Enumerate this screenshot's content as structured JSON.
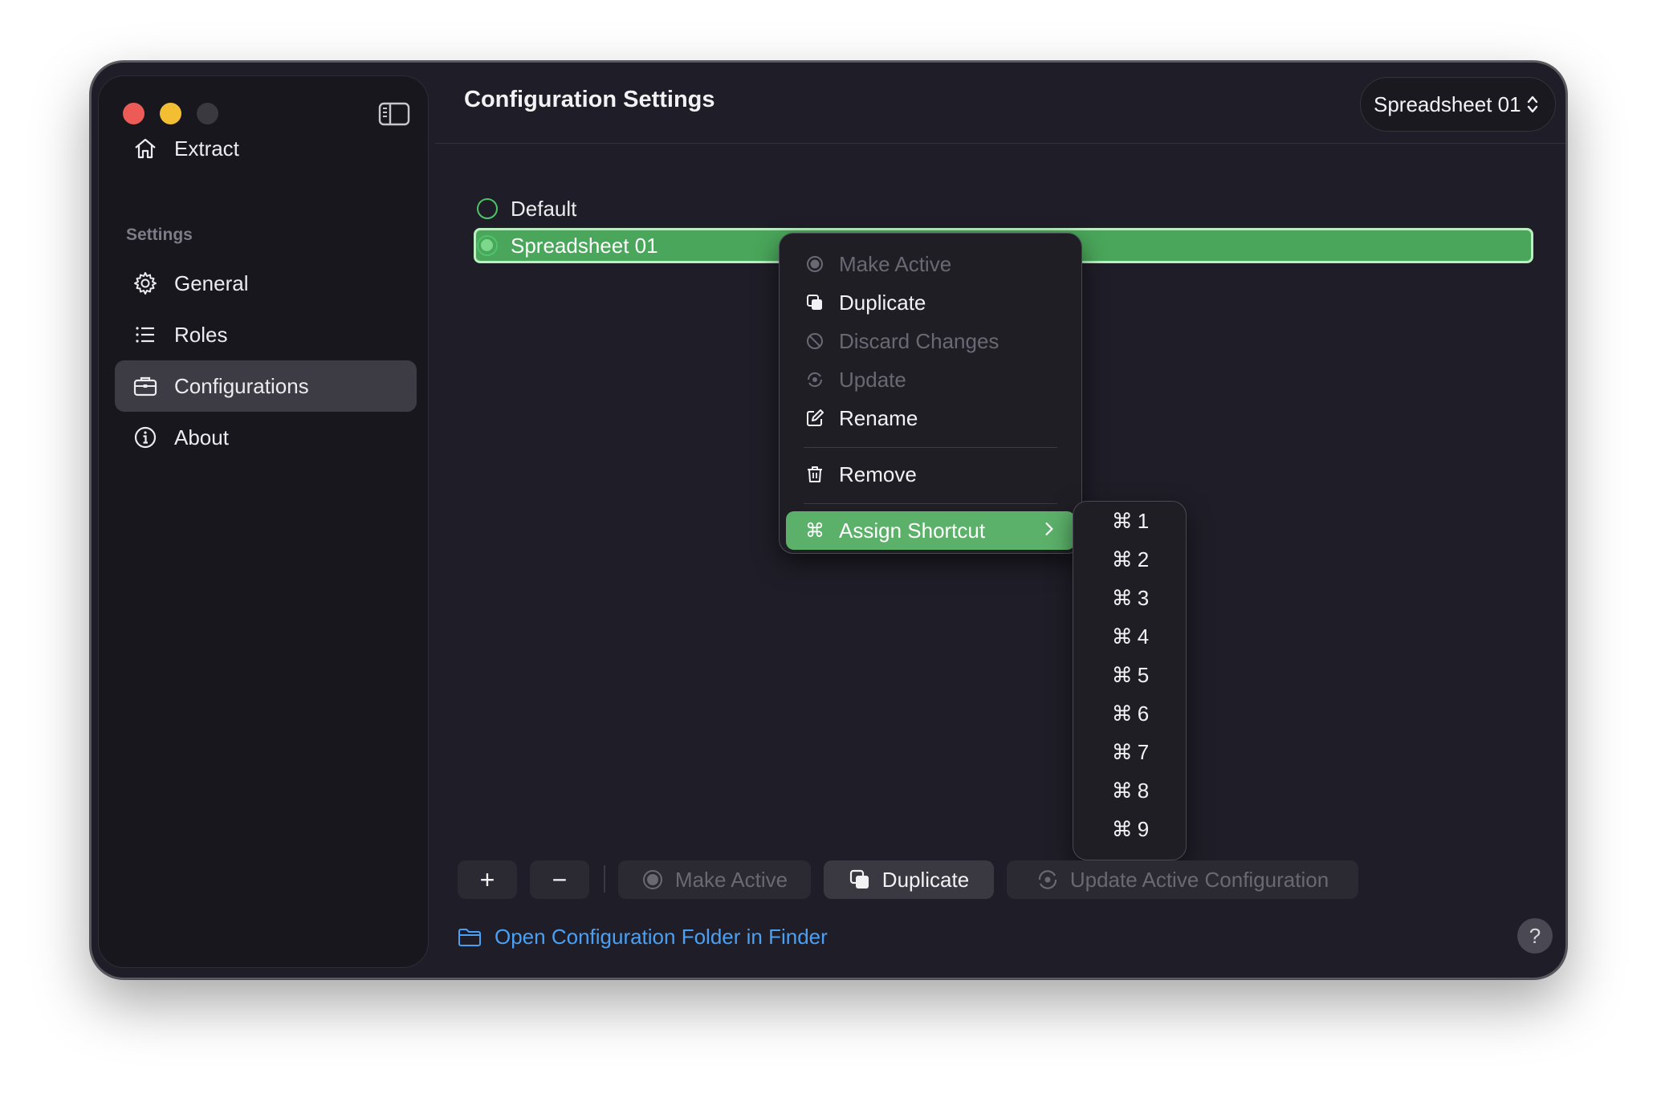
{
  "sidebar": {
    "items": [
      {
        "label": "Extract",
        "icon": "house-icon"
      },
      {
        "label": "General",
        "icon": "gear-icon"
      },
      {
        "label": "Roles",
        "icon": "list-icon"
      },
      {
        "label": "Configurations",
        "icon": "briefcase-icon"
      },
      {
        "label": "About",
        "icon": "info-icon"
      }
    ],
    "section_label": "Settings",
    "active_item": "Configurations"
  },
  "header": {
    "title": "Configuration Settings",
    "picker_value": "Spreadsheet 01"
  },
  "configurations": [
    {
      "name": "Default",
      "active": false,
      "selected": false
    },
    {
      "name": "Spreadsheet 01",
      "active": true,
      "selected": true
    }
  ],
  "context_menu": {
    "items": [
      {
        "label": "Make Active",
        "enabled": false
      },
      {
        "label": "Duplicate",
        "enabled": true
      },
      {
        "label": "Discard Changes",
        "enabled": false
      },
      {
        "label": "Update",
        "enabled": false
      },
      {
        "label": "Rename",
        "enabled": true
      },
      {
        "label": "Remove",
        "enabled": true
      },
      {
        "label": "Assign Shortcut",
        "enabled": true,
        "highlighted": true
      }
    ]
  },
  "shortcut_submenu": {
    "symbol": "⌘",
    "keys": [
      "1",
      "2",
      "3",
      "4",
      "5",
      "6",
      "7",
      "8",
      "9"
    ]
  },
  "toolbar": {
    "add_label": "+",
    "remove_label": "−",
    "make_active_label": "Make Active",
    "duplicate_label": "Duplicate",
    "update_label": "Update Active Configuration"
  },
  "footer": {
    "finder_link": "Open Configuration Folder in Finder",
    "help_label": "?"
  },
  "colors": {
    "accent_green": "#4aa65a",
    "link_blue": "#4aa0f4",
    "window_bg": "#1f1d27"
  }
}
